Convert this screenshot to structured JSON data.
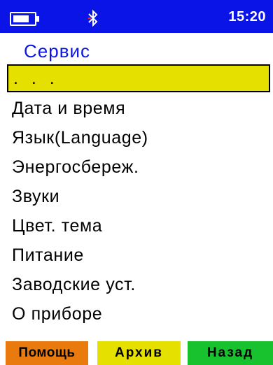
{
  "status_bar": {
    "time": "15:20",
    "battery_icon": "battery-icon",
    "bluetooth_icon": "bluetooth-icon",
    "background_color": "#0a14e6"
  },
  "screen": {
    "title": "Сервис"
  },
  "menu": {
    "items": [
      {
        "label": ". . .",
        "selected": true
      },
      {
        "label": "Дата и время"
      },
      {
        "label": "Язык(Language)"
      },
      {
        "label": "Энергосбереж."
      },
      {
        "label": "Звуки"
      },
      {
        "label": "Цвет. тема"
      },
      {
        "label": "Питание"
      },
      {
        "label": "Заводские уст."
      },
      {
        "label": "О приборе"
      }
    ],
    "selected_color": "#e5e000"
  },
  "softkeys": {
    "help": {
      "label": "Помощь",
      "color": "#e87a0e"
    },
    "archive": {
      "label": "Архив",
      "color": "#e5e000"
    },
    "back": {
      "label": "Назад",
      "color": "#18c22e"
    }
  }
}
